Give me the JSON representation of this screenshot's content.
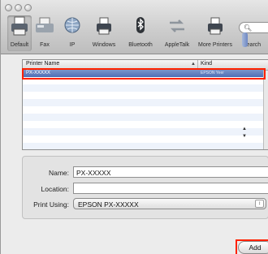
{
  "toolbar": {
    "items": [
      {
        "label": "Default",
        "icon": "default-printer-icon"
      },
      {
        "label": "Fax",
        "icon": "fax-icon"
      },
      {
        "label": "IP",
        "icon": "ip-globe-icon"
      },
      {
        "label": "Windows",
        "icon": "windows-printer-icon"
      },
      {
        "label": "Bluetooth",
        "icon": "bluetooth-icon"
      },
      {
        "label": "AppleTalk",
        "icon": "appletalk-icon"
      },
      {
        "label": "More Printers",
        "icon": "more-printers-icon"
      }
    ],
    "search": {
      "label": "Search",
      "icon": "search-icon"
    }
  },
  "list": {
    "columns": {
      "name": "Printer Name",
      "kind": "Kind"
    },
    "selected": {
      "name": "PX-XXXXX",
      "kind": "EPSON Yeer"
    }
  },
  "form": {
    "name_label": "Name:",
    "name_value": "PX-XXXXX",
    "location_label": "Location:",
    "location_value": "",
    "print_using_label": "Print Using:",
    "print_using_value": "EPSON PX-XXXXX"
  },
  "buttons": {
    "add": "Add"
  },
  "colors": {
    "highlight": "#ff2200",
    "selection": "#5a78bb"
  }
}
